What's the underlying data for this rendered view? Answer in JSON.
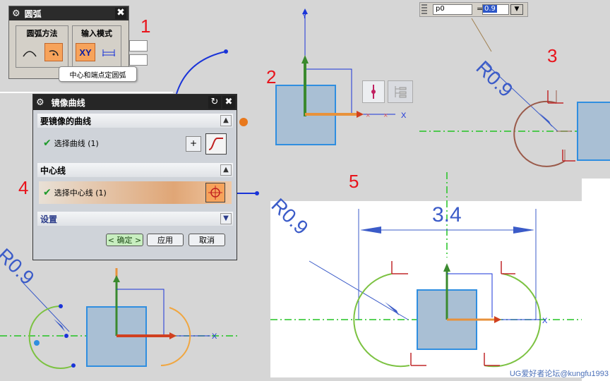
{
  "steps": [
    "1",
    "2",
    "3",
    "4",
    "5"
  ],
  "arc_dialog": {
    "title": "圆弧",
    "method_label": "圆弧方法",
    "input_mode_label": "输入模式",
    "xy_label": "XY",
    "tooltip": "中心和端点定圆弧"
  },
  "mirror_dialog": {
    "title": "镜像曲线",
    "section_curves": "要镜像的曲线",
    "select_curve": "选择曲线 (1)",
    "section_centerline": "中心线",
    "select_centerline": "选择中心线 (1)",
    "section_settings": "设置",
    "ok": "< 确定 >",
    "apply": "应用",
    "cancel": "取消"
  },
  "expression": {
    "name": "p0",
    "equals": "=",
    "value": "0.9"
  },
  "labels": {
    "radius_3": "R0.9",
    "radius_4": "R0.9",
    "radius_5": "R0.9",
    "dimension_5": "3.4",
    "axis_x": "X",
    "axis_y": "Y"
  },
  "watermark": "UG爱好者论坛@kungfu1993",
  "colors": {
    "step_red": "#e8141c",
    "green_axis": "#3a8a2e",
    "orange_axis": "#e8923b",
    "centerline": "#22c422",
    "rect_fill": "#a9bfd4",
    "rect_stroke": "#2f8ee0",
    "dim_blue": "#3b5bc8",
    "arc_green": "#7cc242",
    "arc_orange": "#f0a640",
    "arc_brown": "#9a5a4a"
  }
}
